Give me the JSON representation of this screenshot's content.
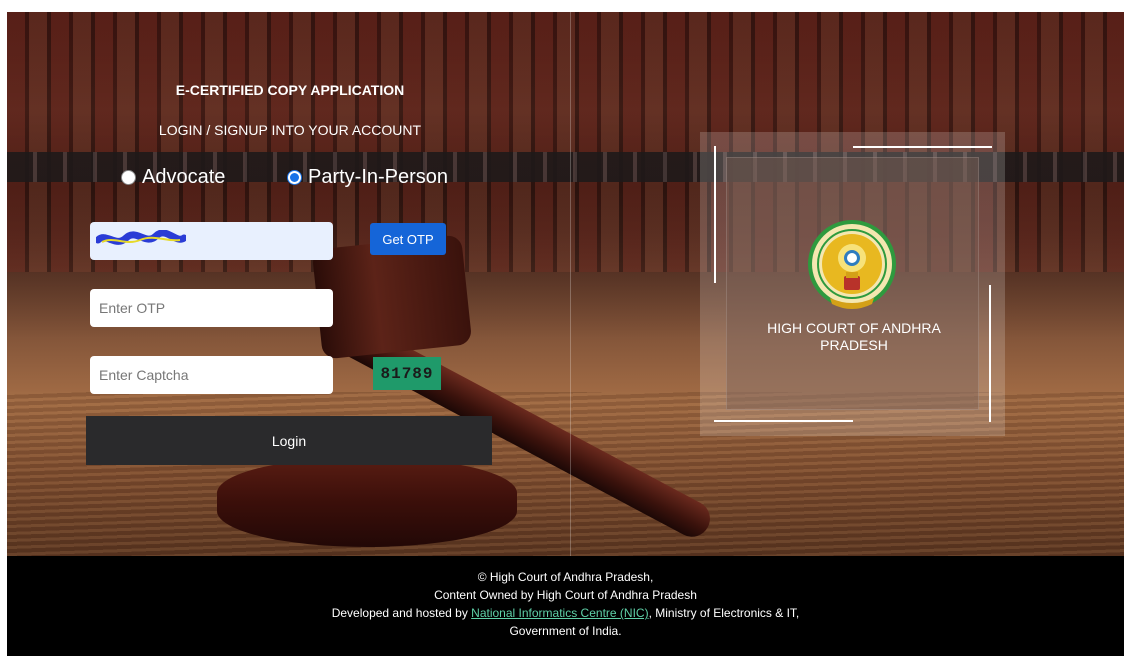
{
  "login_panel": {
    "title": "E-CERTIFIED COPY APPLICATION",
    "subtitle": "LOGIN / SIGNUP INTO YOUR ACCOUNT",
    "roles": [
      {
        "label": "Advocate",
        "checked": false
      },
      {
        "label": "Party-In-Person",
        "checked": true
      }
    ],
    "otp_placeholder": "Enter OTP",
    "captcha_placeholder": "Enter Captcha",
    "get_otp_label": "Get OTP",
    "captcha_code": "81789",
    "login_label": "Login"
  },
  "emblem_card": {
    "court_name": "HIGH COURT OF ANDHRA PRADESH"
  },
  "footer": {
    "line1": "© High Court of Andhra Pradesh,",
    "line2": "Content Owned by High Court of Andhra Pradesh",
    "line3_prefix": "Developed and hosted by",
    "nic_link": "National Informatics Centre (NIC)",
    "line3_suffix": ", Ministry of Electronics & IT,",
    "line4": "Government of India."
  },
  "colors": {
    "otp_button": "#1565d8",
    "captcha_bg": "#1f9a6a",
    "login_button": "#2a2a2c",
    "footer_bg": "#000000",
    "footer_link": "#5fd1a8"
  }
}
